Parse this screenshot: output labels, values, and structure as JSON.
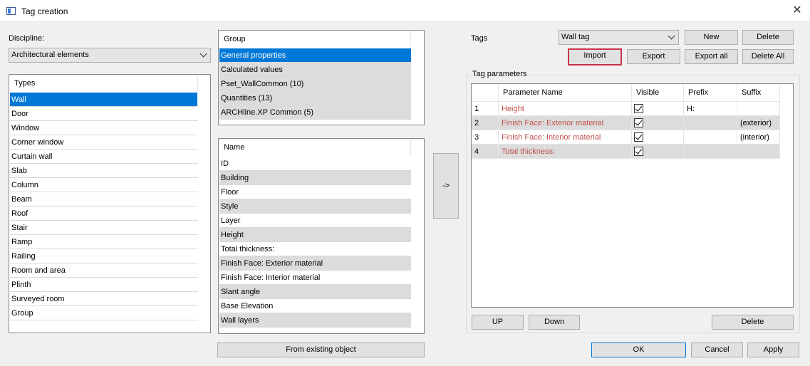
{
  "window": {
    "title": "Tag creation",
    "close_glyph": "✕"
  },
  "discipline": {
    "label": "Discipline:",
    "value": "Architectural elements"
  },
  "types": {
    "header": "Types",
    "items": [
      "Wall",
      "Door",
      "Window",
      "Corner window",
      "Curtain wall",
      "Slab",
      "Column",
      "Beam",
      "Roof",
      "Stair",
      "Ramp",
      "Railing",
      "Room and area",
      "Plinth",
      "Surveyed room",
      "Group"
    ],
    "selected_index": 0
  },
  "groups": {
    "header": "Group",
    "items": [
      "General properties",
      "Calculated values",
      "Pset_WallCommon (10)",
      "Quantities (13)",
      "ARCHline.XP Common (5)"
    ],
    "selected_index": 0
  },
  "names": {
    "header": "Name",
    "items": [
      "ID",
      "Building",
      "Floor",
      "Style",
      "Layer",
      "Height",
      "Total thickness:",
      "Finish Face: Exterior material",
      "Finish Face: Interior material",
      "Slant angle",
      "Base Elevation",
      "Wall layers"
    ]
  },
  "transfer_button": "->",
  "from_existing_button": "From existing object",
  "tags": {
    "label": "Tags",
    "selected": "Wall tag",
    "buttons": {
      "new": "New",
      "delete": "Delete",
      "import": "Import",
      "export": "Export",
      "export_all": "Export all",
      "delete_all": "Delete All"
    }
  },
  "tag_parameters": {
    "caption": "Tag parameters",
    "columns": [
      "",
      "Parameter Name",
      "Visible",
      "Prefix",
      "Suffix"
    ],
    "rows": [
      {
        "num": "1",
        "name": "Height",
        "visible": true,
        "prefix": "H:",
        "suffix": ""
      },
      {
        "num": "2",
        "name": "Finish Face: Exterior material",
        "visible": true,
        "prefix": "",
        "suffix": "(exterior)"
      },
      {
        "num": "3",
        "name": "Finish Face: Interior material",
        "visible": true,
        "prefix": "",
        "suffix": "(interior)"
      },
      {
        "num": "4",
        "name": "Total thickness:",
        "visible": true,
        "prefix": "",
        "suffix": ""
      }
    ],
    "buttons": {
      "up": "UP",
      "down": "Down",
      "delete": "Delete"
    }
  },
  "footer": {
    "ok": "OK",
    "cancel": "Cancel",
    "apply": "Apply"
  },
  "colors": {
    "selection": "#0078d7",
    "focus_border": "#c8324b",
    "param_text": "#c0504d"
  }
}
